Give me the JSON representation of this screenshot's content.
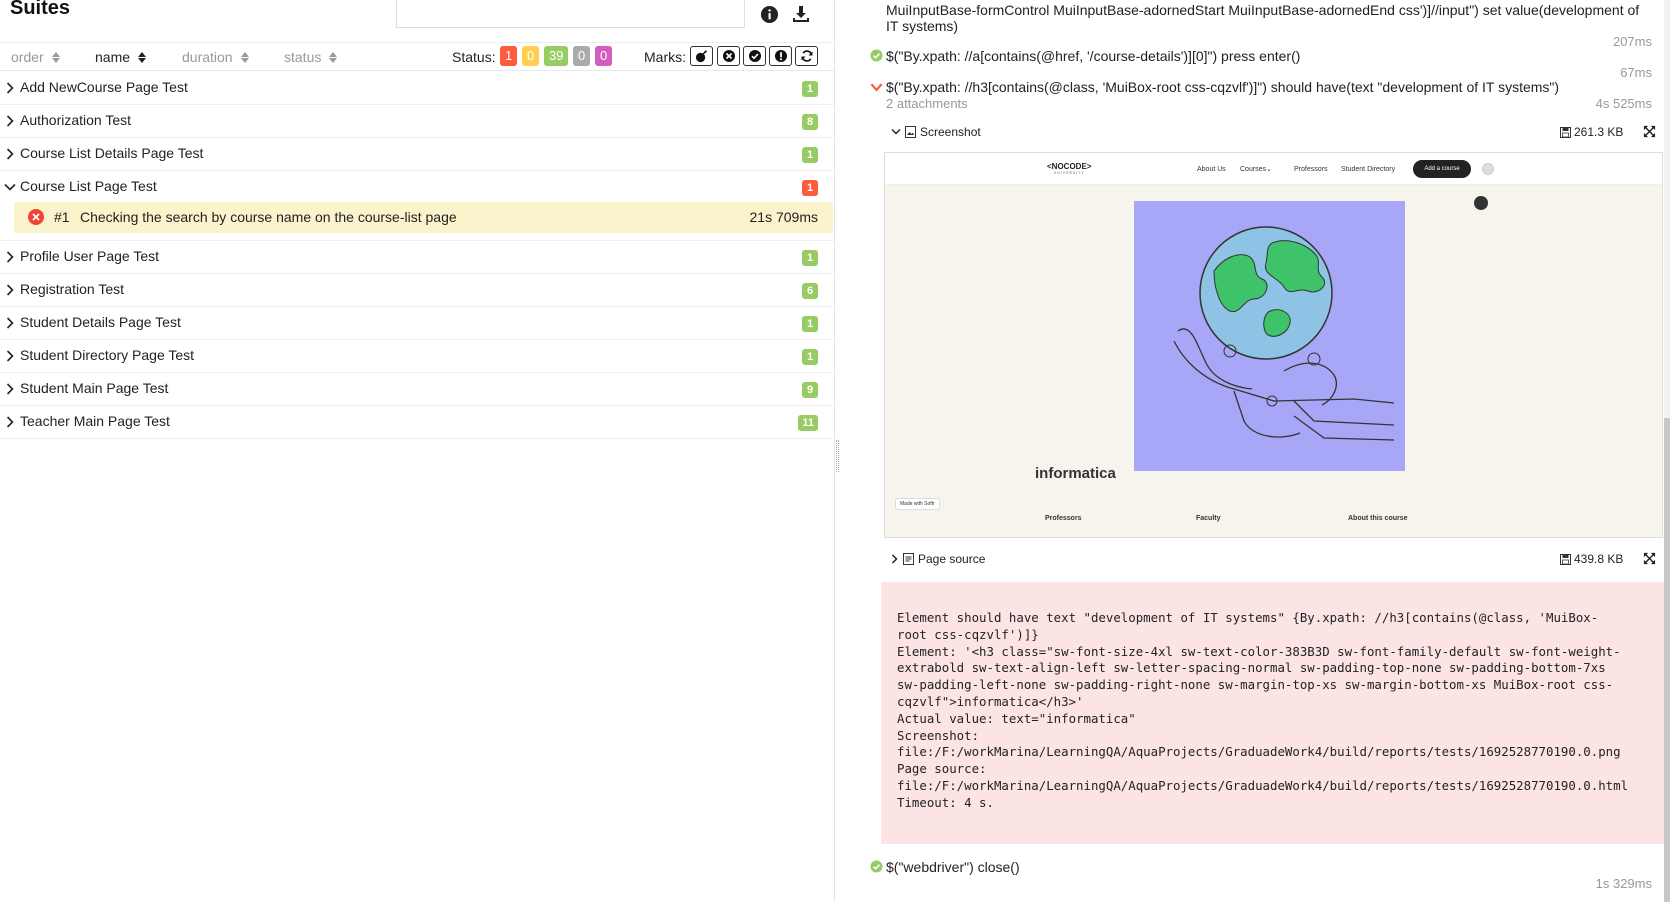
{
  "left": {
    "title": "Suites",
    "sort": {
      "order": "order",
      "name": "name",
      "duration": "duration",
      "status": "status"
    },
    "status_label": "Status:",
    "status_counts": [
      {
        "value": "1",
        "color": "#fd5a3e",
        "kind": "failed"
      },
      {
        "value": "0",
        "color": "#ffd050",
        "kind": "broken"
      },
      {
        "value": "39",
        "color": "#97cc64",
        "kind": "passed"
      },
      {
        "value": "0",
        "color": "#aaaaaa",
        "kind": "skipped"
      },
      {
        "value": "0",
        "color": "#d35ebe",
        "kind": "unknown"
      }
    ],
    "marks_label": "Marks:",
    "suites": [
      {
        "name": "Add NewCourse Page Test",
        "count": "1",
        "color": "#97cc64"
      },
      {
        "name": "Authorization Test",
        "count": "8",
        "color": "#97cc64"
      },
      {
        "name": "Course List Details Page Test",
        "count": "1",
        "color": "#97cc64"
      },
      {
        "name": "Course List Page Test",
        "count": "1",
        "color": "#fd5a3e",
        "expanded": true,
        "child": {
          "num": "#1",
          "name": "Checking the search by course name on the course-list page",
          "duration": "21s 709ms"
        }
      },
      {
        "name": "Profile User Page Test",
        "count": "1",
        "color": "#97cc64"
      },
      {
        "name": "Registration Test",
        "count": "6",
        "color": "#97cc64"
      },
      {
        "name": "Student Details Page Test",
        "count": "1",
        "color": "#97cc64"
      },
      {
        "name": "Student Directory Page Test",
        "count": "1",
        "color": "#97cc64"
      },
      {
        "name": "Student Main Page Test",
        "count": "9",
        "color": "#97cc64"
      },
      {
        "name": "Teacher Main Page Test",
        "count": "11",
        "color": "#97cc64"
      }
    ]
  },
  "right": {
    "step0_line1": "MuiInputBase-formControl MuiInputBase-adornedStart MuiInputBase-adornedEnd css')]//input\") set value(development of",
    "step0_line2": "IT systems)",
    "step0_time": "207ms",
    "step1_text": "$(\"By.xpath: //a[contains(@href, '/course-details')][0]\") press enter()",
    "step1_time": "67ms",
    "step2_text": "$(\"By.xpath: //h3[contains(@class, 'MuiBox-root css-cqzvlf')]\") should have(text \"development of IT systems\")",
    "step2_attachments": "2 attachments",
    "step2_time": "4s 525ms",
    "att1_name": "Screenshot",
    "att1_size": "261.3 KB",
    "att2_name": "Page source",
    "att2_size": "439.8 KB",
    "shot": {
      "logo": "<NOCODE>",
      "logo_sub": "UNIVERSITY",
      "nav": [
        "About Us",
        "Courses",
        "Professors",
        "Student Directory"
      ],
      "cta": "Add a course",
      "course_title": "informatica",
      "made_with": "Made with Softr",
      "footer": [
        "Professors",
        "Faculty",
        "About this course"
      ]
    },
    "error_text": "Element should have text \"development of IT systems\" {By.xpath: //h3[contains(@class, 'MuiBox-\nroot css-cqzvlf')]}\nElement: '<h3 class=\"sw-font-size-4xl sw-text-color-383B3D sw-font-family-default sw-font-weight-\nextrabold sw-text-align-left sw-letter-spacing-normal sw-padding-top-none sw-padding-bottom-7xs\nsw-padding-left-none sw-padding-right-none sw-margin-top-xs sw-margin-bottom-xs MuiBox-root css-\ncqzvlf\">informatica</h3>'\nActual value: text=\"informatica\"\nScreenshot:\nfile:/F:/workMarina/LearningQA/AquaProjects/GraduadeWork4/build/reports/tests/1692528770190.0.png\nPage source:\nfile:/F:/workMarina/LearningQA/AquaProjects/GraduadeWork4/build/reports/tests/1692528770190.0.html\nTimeout: 4 s.",
    "step3_text": "$(\"webdriver\") close()",
    "step3_time": "1s 329ms"
  }
}
